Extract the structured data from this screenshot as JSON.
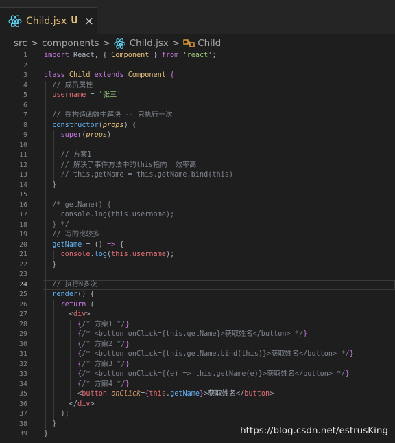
{
  "tab": {
    "file_name": "Child.jsx",
    "badge": "U",
    "close_symbol": "×"
  },
  "breadcrumb": {
    "items": [
      "src",
      "components",
      "Child.jsx",
      "Child"
    ],
    "separator": ">"
  },
  "editor": {
    "active_line": 24,
    "lines": [
      [
        [
          "kw",
          "import"
        ],
        [
          "pun",
          " React, { "
        ],
        [
          "cls",
          "Component"
        ],
        [
          "pun",
          " } "
        ],
        [
          "kw",
          "from"
        ],
        [
          "pun",
          " "
        ],
        [
          "str",
          "'react'"
        ],
        [
          "pun",
          ";"
        ]
      ],
      [],
      [
        [
          "kw",
          "class"
        ],
        [
          "pun",
          " "
        ],
        [
          "cls",
          "Child"
        ],
        [
          "pun",
          " "
        ],
        [
          "kw",
          "extends"
        ],
        [
          "pun",
          " "
        ],
        [
          "cls",
          "Component"
        ],
        [
          "pun",
          " "
        ],
        [
          "brace",
          "{"
        ]
      ],
      [
        [
          "cm",
          "  // 成员属性"
        ]
      ],
      [
        [
          "pun",
          "  "
        ],
        [
          "var",
          "username"
        ],
        [
          "pun",
          " = "
        ],
        [
          "str",
          "'张三'"
        ]
      ],
      [],
      [
        [
          "cm",
          "  // 在构造函数中解决 -- 只执行一次"
        ]
      ],
      [
        [
          "pun",
          "  "
        ],
        [
          "fn",
          "constructor"
        ],
        [
          "pun",
          "("
        ],
        [
          "it",
          "props"
        ],
        [
          "pun",
          ") {"
        ]
      ],
      [
        [
          "pun",
          "    "
        ],
        [
          "kw",
          "super"
        ],
        [
          "pun",
          "("
        ],
        [
          "it",
          "props"
        ],
        [
          "pun",
          ")"
        ]
      ],
      [],
      [
        [
          "cm",
          "    // 方案1"
        ]
      ],
      [
        [
          "cm",
          "    // 解决了事件方法中的this指向  效率高"
        ]
      ],
      [
        [
          "cm",
          "    // this.getName = this.getName.bind(this)"
        ]
      ],
      [
        [
          "pun",
          "  }"
        ]
      ],
      [],
      [
        [
          "cm",
          "  /* getName() {"
        ]
      ],
      [
        [
          "cm",
          "    console.log(this.username);"
        ]
      ],
      [
        [
          "cm",
          "  } */"
        ]
      ],
      [
        [
          "cm",
          "  // 写的比较多"
        ]
      ],
      [
        [
          "pun",
          "  "
        ],
        [
          "fn",
          "getName"
        ],
        [
          "pun",
          " = () "
        ],
        [
          "kw",
          "=>"
        ],
        [
          "pun",
          " {"
        ]
      ],
      [
        [
          "pun",
          "    "
        ],
        [
          "var",
          "console"
        ],
        [
          "pun",
          "."
        ],
        [
          "fn",
          "log"
        ],
        [
          "pun",
          "("
        ],
        [
          "var",
          "this"
        ],
        [
          "pun",
          "."
        ],
        [
          "var",
          "username"
        ],
        [
          "pun",
          ");"
        ]
      ],
      [
        [
          "pun",
          "  }"
        ]
      ],
      [],
      [
        [
          "cm",
          "  // 执行N多次"
        ]
      ],
      [
        [
          "pun",
          "  "
        ],
        [
          "fn",
          "render"
        ],
        [
          "pun",
          "() {"
        ]
      ],
      [
        [
          "pun",
          "    "
        ],
        [
          "kw",
          "return"
        ],
        [
          "pun",
          " ("
        ]
      ],
      [
        [
          "pun",
          "      <"
        ],
        [
          "tag",
          "div"
        ],
        [
          "pun",
          ">"
        ]
      ],
      [
        [
          "pun",
          "        "
        ],
        [
          "brace",
          "{"
        ],
        [
          "cm",
          "/* 方案1 */"
        ],
        [
          "brace",
          "}"
        ]
      ],
      [
        [
          "pun",
          "        "
        ],
        [
          "brace",
          "{"
        ],
        [
          "cm",
          "/* <button onClick={this.getName}>获取姓名</button> */"
        ],
        [
          "brace",
          "}"
        ]
      ],
      [
        [
          "pun",
          "        "
        ],
        [
          "brace",
          "{"
        ],
        [
          "cm",
          "/* 方案2 */"
        ],
        [
          "brace",
          "}"
        ]
      ],
      [
        [
          "pun",
          "        "
        ],
        [
          "brace",
          "{"
        ],
        [
          "cm",
          "/* <button onClick={this.getName.bind(this)}>获取姓名</button> */"
        ],
        [
          "brace",
          "}"
        ]
      ],
      [
        [
          "pun",
          "        "
        ],
        [
          "brace",
          "{"
        ],
        [
          "cm",
          "/* 方案3 */"
        ],
        [
          "brace",
          "}"
        ]
      ],
      [
        [
          "pun",
          "        "
        ],
        [
          "brace",
          "{"
        ],
        [
          "cm",
          "/* <button onClick={(e) => this.getName(e)}>获取姓名</button> */"
        ],
        [
          "brace",
          "}"
        ]
      ],
      [
        [
          "pun",
          "        "
        ],
        [
          "brace",
          "{"
        ],
        [
          "cm",
          "/* 方案4 */"
        ],
        [
          "brace",
          "}"
        ]
      ],
      [
        [
          "pun",
          "        <"
        ],
        [
          "tag",
          "button"
        ],
        [
          "pun",
          " "
        ],
        [
          "attr",
          "onClick"
        ],
        [
          "pun",
          "="
        ],
        [
          "brace",
          "{"
        ],
        [
          "var",
          "this"
        ],
        [
          "pun",
          "."
        ],
        [
          "fn",
          "getName"
        ],
        [
          "brace",
          "}"
        ],
        [
          "pun",
          ">获取姓名</"
        ],
        [
          "tag",
          "button"
        ],
        [
          "pun",
          ">"
        ]
      ],
      [
        [
          "pun",
          "      </"
        ],
        [
          "tag",
          "div"
        ],
        [
          "pun",
          ">"
        ]
      ],
      [
        [
          "pun",
          "    );"
        ]
      ],
      [
        [
          "pun",
          "  }"
        ]
      ],
      [
        [
          "pun",
          "}"
        ]
      ]
    ]
  },
  "watermark": "https://blog.csdn.net/estrusKing",
  "colors": {
    "background": "#1e1e1e",
    "tab_modified": "#e5c07b",
    "react_icon": "#61dafb",
    "symbol_icon": "#e5a03b"
  }
}
